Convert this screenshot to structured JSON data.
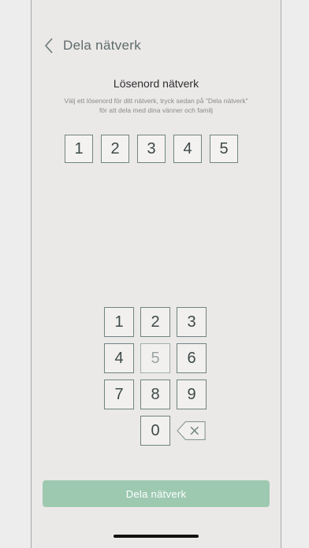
{
  "header": {
    "back_icon": "chevron-left-icon",
    "title": "Dela nätverk"
  },
  "heading": "Lösenord nätverk",
  "description": {
    "line1": "Välj ett lösenord för ditt nätverk, tryck sedan på \"Dela nätverk\"",
    "line2": "för att dela med  dina vänner och familj"
  },
  "code": [
    "1",
    "2",
    "3",
    "4",
    "5"
  ],
  "keypad": {
    "keys": [
      "1",
      "2",
      "3",
      "4",
      "5",
      "6",
      "7",
      "8",
      "9"
    ],
    "zero": "0",
    "disabled_key": "5",
    "delete_icon": "backspace-icon"
  },
  "cta_label": "Dela nätverk",
  "colors": {
    "accent": "#9dc9b1",
    "border": "#6f8580",
    "background": "#ebe8e8"
  }
}
